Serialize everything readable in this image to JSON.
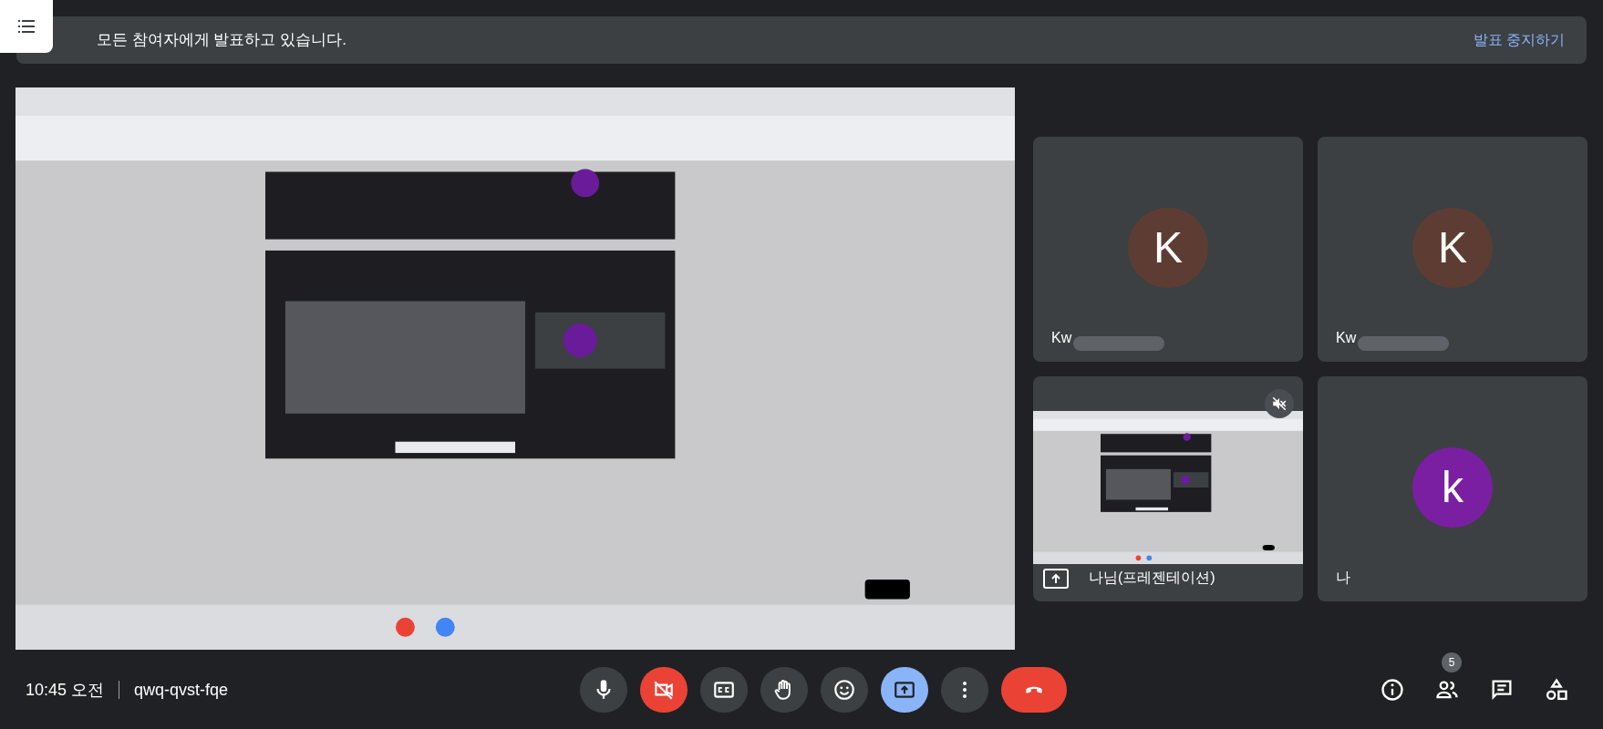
{
  "banner": {
    "text": "모든 참여자에게 발표하고 있습니다.",
    "action": "발표 중지하기"
  },
  "tiles": [
    {
      "kind": "avatar",
      "initial": "K",
      "color": "#5d3d33",
      "name": "Kw",
      "redacted": true
    },
    {
      "kind": "avatar",
      "initial": "K",
      "color": "#5d3d33",
      "name": "Kw",
      "redacted": true
    },
    {
      "kind": "screen",
      "name": "나님(프레젠테이션)",
      "muted": true
    },
    {
      "kind": "avatar",
      "initial": "k",
      "color": "#7b1fa2",
      "name": "나",
      "redacted": false
    }
  ],
  "footer": {
    "time": "10:45 오전",
    "meeting_code": "qwq-qvst-fqe"
  },
  "controls": [
    {
      "kind": "mic",
      "off": false,
      "active": false
    },
    {
      "kind": "camera",
      "off": true,
      "active": false
    },
    {
      "kind": "captions",
      "off": false,
      "active": false
    },
    {
      "kind": "hand",
      "off": false,
      "active": false
    },
    {
      "kind": "emoji",
      "off": false,
      "active": false
    },
    {
      "kind": "present",
      "off": false,
      "active": true
    },
    {
      "kind": "more",
      "off": false,
      "active": false
    },
    {
      "kind": "hangup"
    }
  ],
  "side_controls": [
    {
      "kind": "info"
    },
    {
      "kind": "people",
      "badge": "5"
    },
    {
      "kind": "chat"
    },
    {
      "kind": "activities"
    }
  ]
}
